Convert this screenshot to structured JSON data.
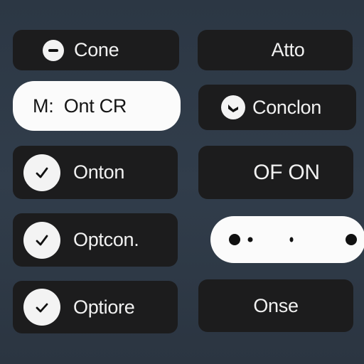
{
  "options": {
    "item_1": {
      "label": "Cone"
    },
    "item_2": {
      "label": "Atto"
    },
    "item_3": {
      "label": "M:  Ont CR"
    },
    "item_4": {
      "label": "Conclon"
    },
    "item_5": {
      "label": "Onton"
    },
    "item_6": {
      "label": "OF ON"
    },
    "item_7": {
      "label": "Optcon."
    },
    "item_8": {
      "label": "Optiore"
    },
    "item_9": {
      "label": "Onse"
    }
  },
  "icons": {
    "item_1": "minus-icon",
    "item_4": "chevron-icon",
    "item_5": "checkmark-icon",
    "item_7": "checkmark-icon",
    "item_8": "checkmark-icon"
  },
  "colors": {
    "background": "#2f3a47",
    "button_dark": "#1c1c1d",
    "button_light": "#fbfbfb",
    "text_light": "#f1f1f1",
    "text_dark": "#151515"
  }
}
